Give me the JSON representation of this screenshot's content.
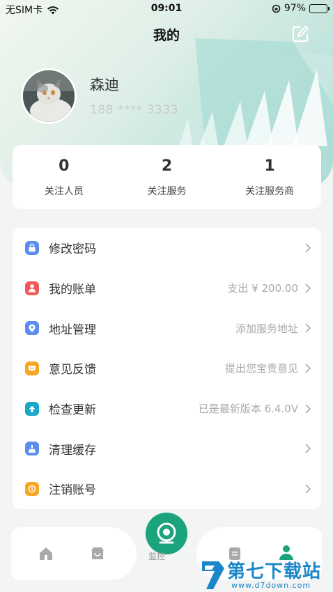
{
  "status_bar": {
    "carrier": "无SIM卡",
    "time": "09:01",
    "battery": "97%",
    "battery_level": 0.97
  },
  "header": {
    "title": "我的",
    "edit_icon": "edit-icon"
  },
  "profile": {
    "name": "森迪",
    "phone": "188 **** 3333"
  },
  "stats": [
    {
      "value": "0",
      "label": "关注人员"
    },
    {
      "value": "2",
      "label": "关注服务"
    },
    {
      "value": "1",
      "label": "关注服务商"
    }
  ],
  "menu": [
    {
      "label": "修改密码",
      "value": "",
      "icon": "lock-icon",
      "color": "#5b8def"
    },
    {
      "label": "我的账单",
      "value": "支出 ¥ 200.00",
      "icon": "user-icon",
      "color": "#f05a5a"
    },
    {
      "label": "地址管理",
      "value": "添加服务地址",
      "icon": "location-icon",
      "color": "#5b8def"
    },
    {
      "label": "意见反馈",
      "value": "提出您宝贵意见",
      "icon": "chat-icon",
      "color": "#f6a623"
    },
    {
      "label": "检查更新",
      "value": "已是最新版本 6.4.0V",
      "icon": "upload-icon",
      "color": "#1aa7c8"
    },
    {
      "label": "清理缓存",
      "value": "",
      "icon": "broom-icon",
      "color": "#5b8def"
    },
    {
      "label": "注销账号",
      "value": "",
      "icon": "power-icon",
      "color": "#f6a623"
    }
  ],
  "tabbar": {
    "center_label": "监控",
    "accent": "#1aa37c"
  },
  "watermark": {
    "title": "第七下载站",
    "url": "www.d7down.com"
  }
}
